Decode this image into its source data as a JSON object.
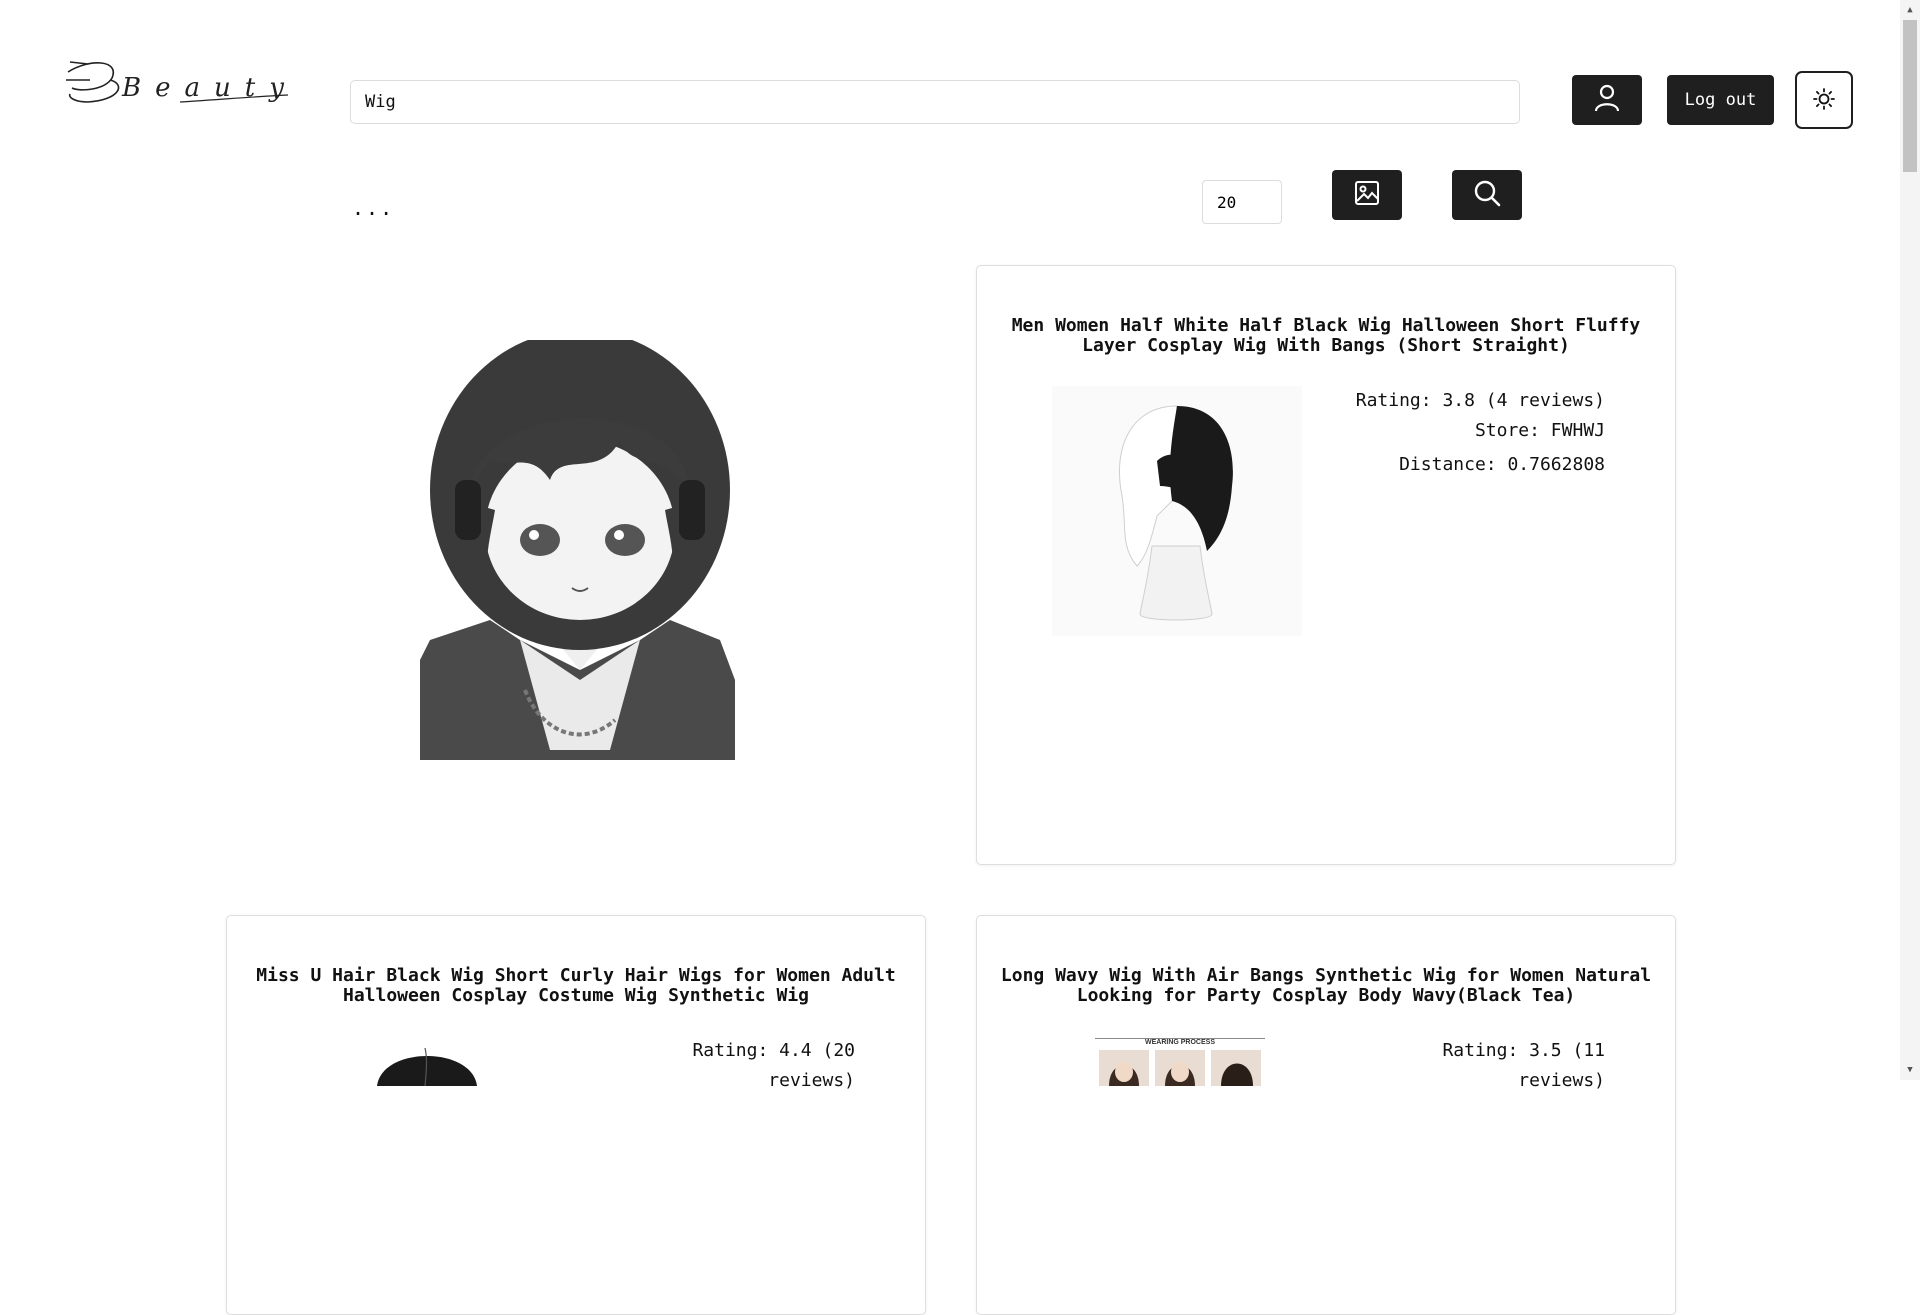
{
  "header": {
    "logo_text": "Beauty",
    "search": {
      "value": "Wig",
      "placeholder": ""
    },
    "user_icon": "user-icon",
    "logout_label": "Log out",
    "theme_icon": "sun-icon"
  },
  "toolbar": {
    "ellipsis": "...",
    "count_value": "20",
    "image_search_icon": "image-icon",
    "search_icon": "search-icon"
  },
  "query_image": {
    "alt": "query image"
  },
  "results": [
    {
      "title": "Men Women Half White Half Black Wig Halloween Short Fluffy Layer Cosplay Wig With Bangs (Short Straight)",
      "rating": "Rating: 3.8 (4 reviews)",
      "store": "Store: FWHWJ",
      "distance": "Distance: 0.7662808"
    },
    {
      "title": "Miss U Hair Black Wig Short Curly Hair Wigs for Women Adult Halloween Cosplay Costume Wig Synthetic Wig",
      "rating": "Rating: 4.4 (20 reviews)"
    },
    {
      "title": "Long Wavy Wig With Air Bangs Synthetic Wig for Women Natural Looking for Party Cosplay Body Wavy(Black Tea)",
      "rating": "Rating: 3.5 (11 reviews)",
      "image_caption": "WEARING PROCESS"
    }
  ]
}
